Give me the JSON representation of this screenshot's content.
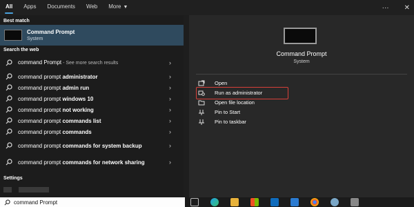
{
  "tabs": [
    {
      "label": "All"
    },
    {
      "label": "Apps"
    },
    {
      "label": "Documents"
    },
    {
      "label": "Web"
    },
    {
      "label": "More"
    }
  ],
  "window_controls": {
    "more": "···",
    "close": "✕"
  },
  "best_match": {
    "section_label": "Best match",
    "title": "Command Prompt",
    "subtitle": "System"
  },
  "web": {
    "section_label": "Search the web",
    "results": [
      {
        "prefix": "command Prompt",
        "bold": "",
        "suffix": " - See more search results"
      },
      {
        "prefix": "command prompt ",
        "bold": "administrator",
        "suffix": ""
      },
      {
        "prefix": "command prompt ",
        "bold": "admin run",
        "suffix": ""
      },
      {
        "prefix": "command prompt ",
        "bold": "windows 10",
        "suffix": ""
      },
      {
        "prefix": "command prompt ",
        "bold": "not working",
        "suffix": ""
      },
      {
        "prefix": "command prompt ",
        "bold": "commands list",
        "suffix": ""
      },
      {
        "prefix": "command prompt ",
        "bold": "commands",
        "suffix": ""
      },
      {
        "prefix": "command prompt ",
        "bold": "commands for system backup",
        "suffix": ""
      },
      {
        "prefix": "command prompt ",
        "bold": "commands for network sharing",
        "suffix": ""
      }
    ]
  },
  "settings": {
    "section_label": "Settings"
  },
  "detail": {
    "title": "Command Prompt",
    "type": "System",
    "actions": [
      {
        "label": "Open",
        "icon": "open-icon"
      },
      {
        "label": "Run as administrator",
        "icon": "shield-run-icon"
      },
      {
        "label": "Open file location",
        "icon": "folder-icon"
      },
      {
        "label": "Pin to Start",
        "icon": "pin-icon"
      },
      {
        "label": "Pin to taskbar",
        "icon": "pin-icon"
      }
    ]
  },
  "search": {
    "query": "command Prompt"
  },
  "taskbar_icons": [
    "task-view-icon",
    "edge-icon",
    "file-explorer-icon",
    "store-icon",
    "outlook-icon",
    "photos-icon",
    "chrome-icon",
    "settings-icon",
    "app-icon"
  ],
  "colors": {
    "accent": "#4aa3df",
    "selected_row": "#2f4a5e",
    "highlight_border": "#d9403a"
  }
}
